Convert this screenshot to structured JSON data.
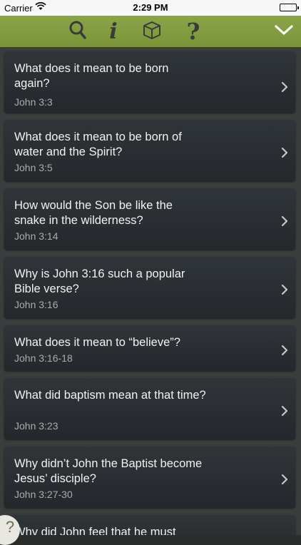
{
  "status_bar": {
    "carrier": "Carrier",
    "time": "2:29 PM"
  },
  "toolbar": {
    "icons": [
      "search-icon",
      "info-icon",
      "cube-icon",
      "question-icon",
      "chevron-down-icon"
    ],
    "info_glyph": "i",
    "question_glyph": "?"
  },
  "questions": [
    {
      "question": "What does it mean to be born again?",
      "reference": "John 3:3"
    },
    {
      "question": "What does it mean to be born of water and the Spirit?",
      "reference": "John 3:5"
    },
    {
      "question": "How would the Son be like the snake in the wilderness?",
      "reference": "John 3:14"
    },
    {
      "question": "Why is John 3:16 such a popular Bible verse?",
      "reference": "John 3:16"
    },
    {
      "question": "What does it mean to “believe”?",
      "reference": "John 3:16-18"
    },
    {
      "question": "What did baptism mean at that time?",
      "reference": "John 3:23"
    },
    {
      "question": "Why didn’t John the Baptist become Jesus’ disciple?",
      "reference": "John 3:27-30"
    },
    {
      "question": "Why did John feel that he must",
      "reference": ""
    }
  ],
  "help_button": {
    "label": "?"
  }
}
